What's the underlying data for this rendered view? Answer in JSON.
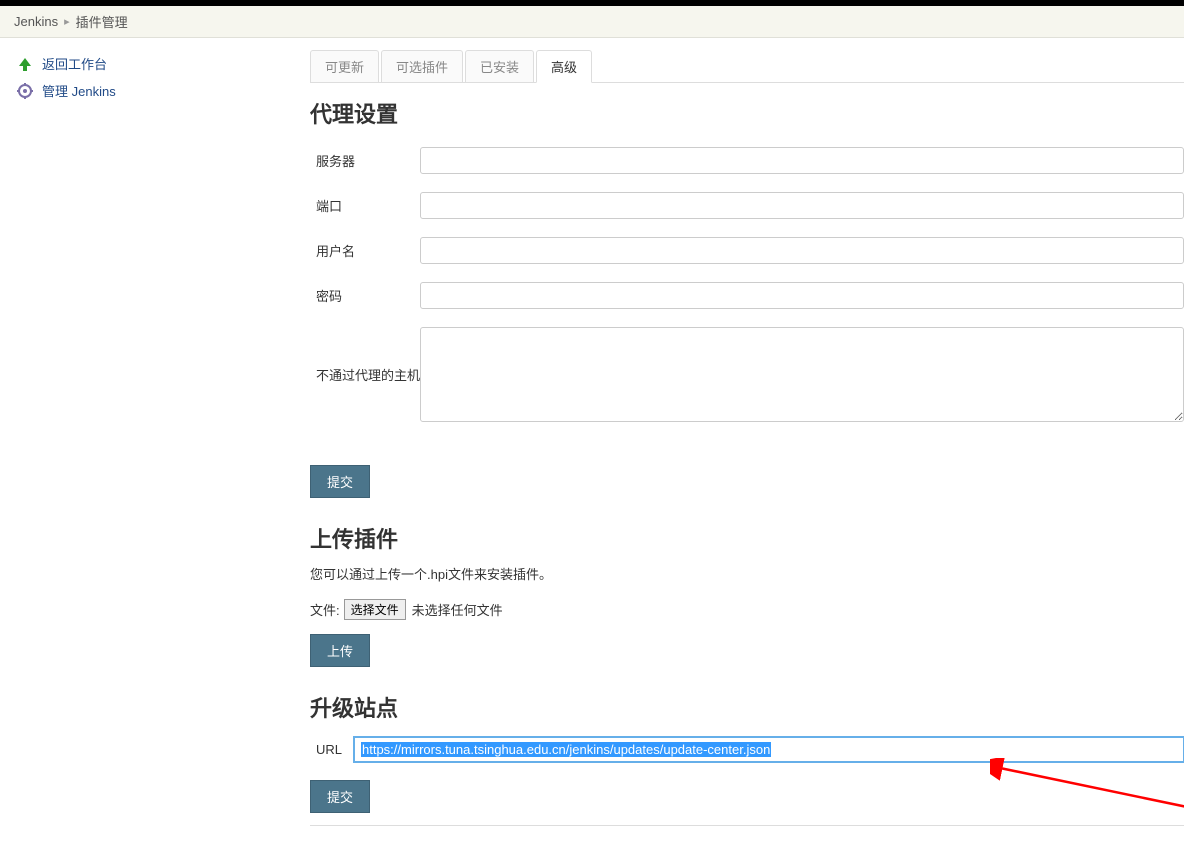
{
  "breadcrumb": {
    "root": "Jenkins",
    "current": "插件管理"
  },
  "sidebar": {
    "back_label": "返回工作台",
    "manage_label": "管理 Jenkins"
  },
  "tabs": {
    "updatable": "可更新",
    "available": "可选插件",
    "installed": "已安装",
    "advanced": "高级"
  },
  "proxy": {
    "title": "代理设置",
    "server_label": "服务器",
    "server_value": "",
    "port_label": "端口",
    "port_value": "",
    "user_label": "用户名",
    "user_value": "",
    "password_label": "密码",
    "password_value": "",
    "noproxy_label": "不通过代理的主机",
    "noproxy_value": "",
    "submit_label": "提交"
  },
  "upload": {
    "title": "上传插件",
    "desc": "您可以通过上传一个.hpi文件来安装插件。",
    "file_label": "文件:",
    "choose_button": "选择文件",
    "no_file": "未选择任何文件",
    "upload_button": "上传"
  },
  "updatesite": {
    "title": "升级站点",
    "url_label": "URL",
    "url_value": "https://mirrors.tuna.tsinghua.edu.cn/jenkins/updates/update-center.json",
    "submit_label": "提交"
  }
}
